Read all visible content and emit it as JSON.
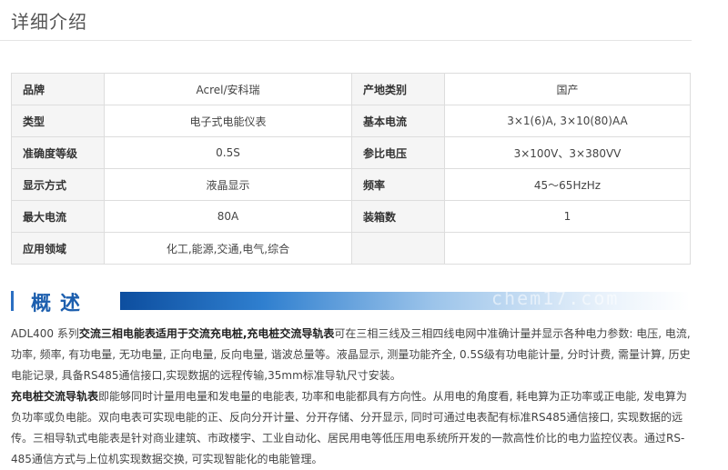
{
  "header": {
    "title": "详细介绍"
  },
  "spec_table": {
    "rows": [
      {
        "k1": "品牌",
        "v1": "Acrel/安科瑞",
        "k2": "产地类别",
        "v2": "国产"
      },
      {
        "k1": "类型",
        "v1": "电子式电能仪表",
        "k2": "基本电流",
        "v2": "3×1(6)A, 3×10(80)AA"
      },
      {
        "k1": "准确度等级",
        "v1": "0.5S",
        "k2": "参比电压",
        "v2": "3×100V、3×380VV"
      },
      {
        "k1": "显示方式",
        "v1": "液晶显示",
        "k2": "频率",
        "v2": "45～65HzHz"
      },
      {
        "k1": "最大电流",
        "v1": "80A",
        "k2": "装箱数",
        "v2": "1"
      },
      {
        "k1": "应用领域",
        "v1": "化工,能源,交通,电气,综合",
        "k2": "",
        "v2": ""
      }
    ]
  },
  "overview": {
    "title": "概述",
    "watermark": "chem17.com",
    "p1": {
      "a": "ADL400 系列",
      "b": "交流三相电能表适用于交流充电桩,充电桩交流导轨表",
      "c": "可在三相三线及三相四线电网中准确计量并显示各种电力参数: 电压, 电流, 功率, 频率, 有功电量, 无功电量, 正向电量, 反向电量, 谐波总量等。液晶显示, 测量功能齐全, 0.5S级有功电能计量, 分时计费, 需量计算, 历史电能记录, 具备RS485通信接口,实现数据的远程传输,35mm标准导轨尺寸安装。"
    },
    "p2": {
      "b": "充电桩交流导轨表",
      "c": "即能够同时计量用电量和发电量的电能表, 功率和电能都具有方向性。从用电的角度看, 耗电算为正功率或正电能, 发电算为负功率或负电能。双向电表可实现电能的正、反向分开计量、分开存储、分开显示, 同时可通过电表配有标准RS485通信接口, 实现数据的远传。三相导轨式电能表是针对商业建筑、市政楼宇、工业自动化、居民用电等低压用电系统所开发的一款高性价比的电力监控仪表。通过RS-485通信方式与上位机实现数据交换, 可实现智能化的电能管理。"
    }
  }
}
